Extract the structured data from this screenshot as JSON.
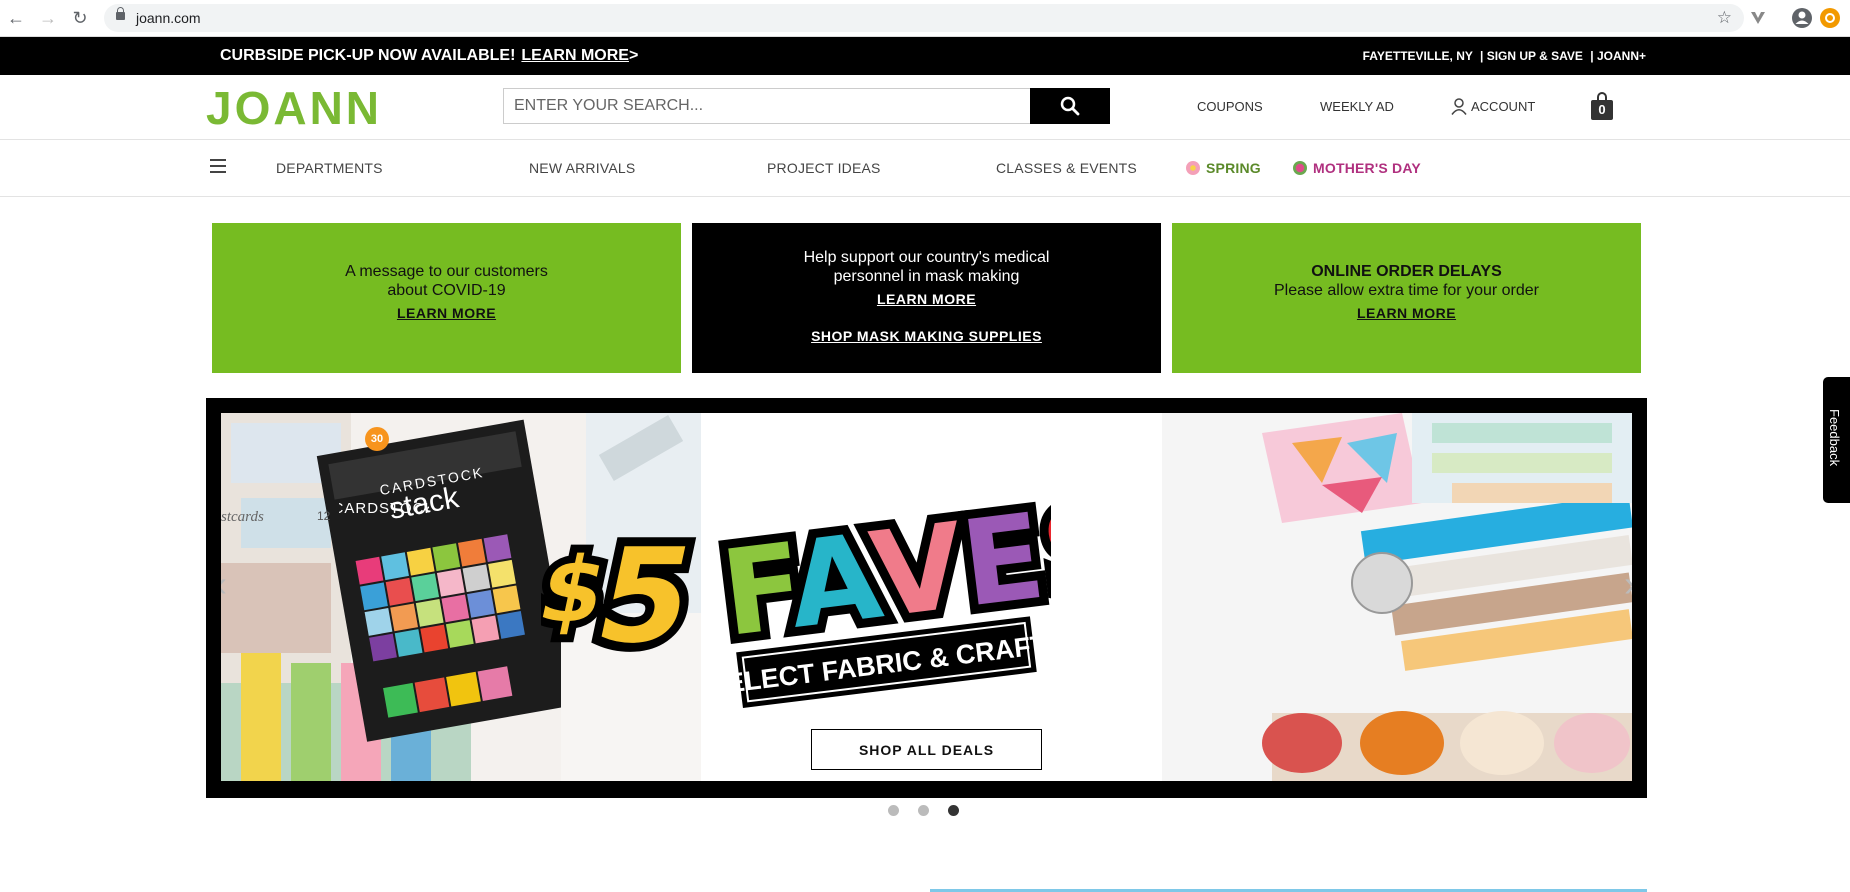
{
  "browser": {
    "url": "joann.com"
  },
  "promo": {
    "text": "CURBSIDE PICK-UP NOW AVAILABLE!",
    "link": "LEARN MORE",
    "arrow": ">",
    "location": "FAYETTEVILLE, NY",
    "signup": "| SIGN UP & SAVE",
    "joann_plus": "| JOANN+"
  },
  "header": {
    "logo": "JOANN",
    "search_placeholder": "ENTER YOUR SEARCH...",
    "coupons": "COUPONS",
    "weekly_ad": "WEEKLY AD",
    "account": "ACCOUNT",
    "cart_count": "0"
  },
  "nav": {
    "items": [
      {
        "label": "DEPARTMENTS"
      },
      {
        "label": "NEW ARRIVALS"
      },
      {
        "label": "PROJECT IDEAS"
      },
      {
        "label": "CLASSES & EVENTS"
      },
      {
        "label": "SPRING"
      },
      {
        "label": "MOTHER'S DAY"
      }
    ]
  },
  "info_boxes": [
    {
      "line1": "A message to our customers",
      "line2": "about COVID-19",
      "link": "LEARN MORE"
    },
    {
      "line1": "Help support our country's medical",
      "line2": "personnel in mask making",
      "link": "LEARN MORE",
      "link2": "SHOP MASK MAKING SUPPLIES"
    },
    {
      "title": "ONLINE ORDER DELAYS",
      "line1": "Please allow extra time for your order",
      "link": "LEARN MORE"
    }
  ],
  "hero": {
    "dollar": "$",
    "five": "5",
    "faves": "FAVES",
    "subtitle": "SELECT FABRIC & CRAFTS",
    "button": "SHOP ALL DEALS",
    "cardstock_title": "CARDSTOCK",
    "cardstock_sub": "stack",
    "cardstock_badge": "30",
    "cards_label": "stcards",
    "cards_num": "12",
    "slide_count": 3,
    "active_slide": 3
  },
  "feedback": "Feedback",
  "colors": {
    "brand_green": "#7ab934",
    "box_green": "#76bc21",
    "mothers_day": "#b0307f",
    "spring": "#5b8a2a"
  }
}
